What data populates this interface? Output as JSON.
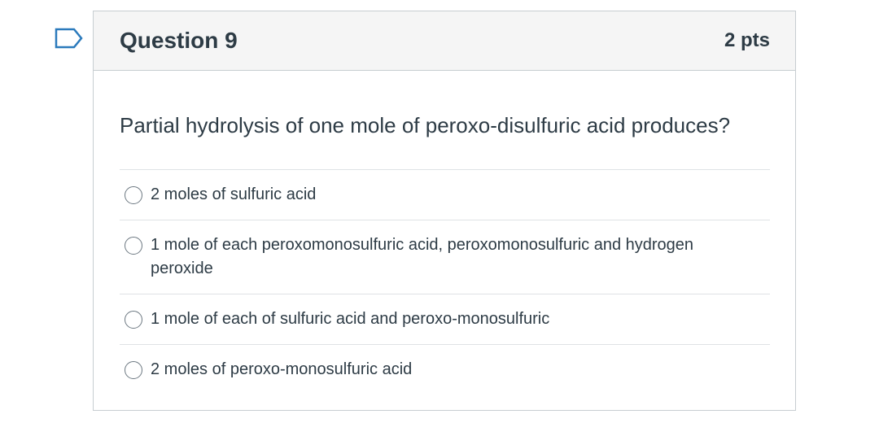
{
  "question": {
    "title": "Question 9",
    "points": "2 pts",
    "text": "Partial hydrolysis of one mole of peroxo-disulfuric acid produces?",
    "answers": [
      {
        "label": "2 moles of sulfuric acid",
        "selected": false
      },
      {
        "label": "1 mole of each peroxomonosulfuric acid, peroxomonosulfuric and hydrogen peroxide",
        "selected": false
      },
      {
        "label": "1 mole of each of sulfuric acid and peroxo-monosulfuric",
        "selected": false
      },
      {
        "label": "2 moles of peroxo-monosulfuric acid",
        "selected": false
      }
    ]
  },
  "icons": {
    "flag": "bookmark-flag-icon"
  },
  "colors": {
    "accent": "#2b7abc",
    "text": "#2d3b45",
    "header_bg": "#f5f5f5",
    "border": "#c7cdd1"
  }
}
